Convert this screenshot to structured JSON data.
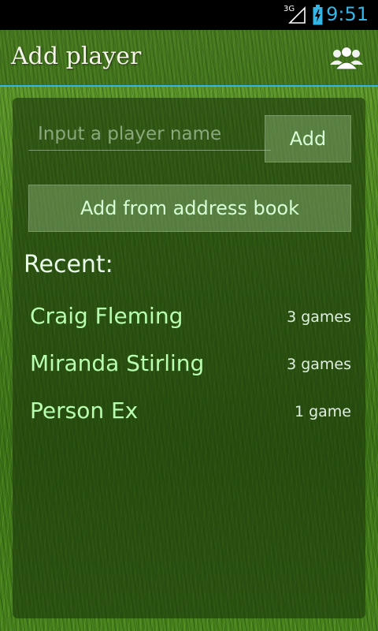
{
  "status_bar": {
    "network_label": "3G",
    "time": "9:51",
    "signal_icon": "signal-icon",
    "battery_icon": "battery-charging-icon",
    "accent_color": "#33b5e5"
  },
  "action_bar": {
    "title": "Add player",
    "players_icon": "players-icon"
  },
  "form": {
    "name_placeholder": "Input a player name",
    "name_value": "",
    "add_label": "Add",
    "address_book_label": "Add from address book"
  },
  "recent": {
    "heading": "Recent:",
    "players": [
      {
        "name": "Craig Fleming",
        "games": "3 games"
      },
      {
        "name": "Miranda Stirling",
        "games": "3 games"
      },
      {
        "name": "Person Ex",
        "games": "1 game"
      }
    ]
  },
  "colors": {
    "name_text": "#b8ffb0",
    "button_text": "#d6ffd6",
    "divider": "#33b5e5"
  }
}
